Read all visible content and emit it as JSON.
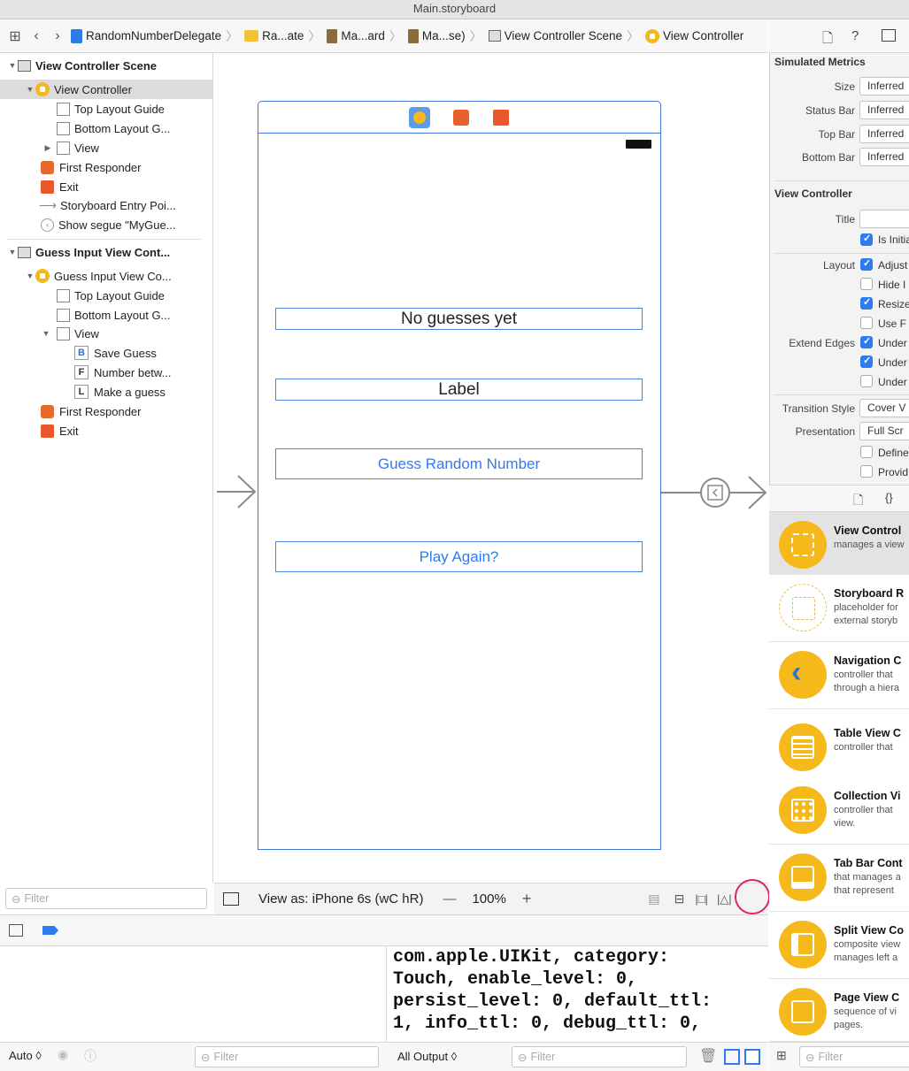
{
  "window": {
    "title": "Main.storyboard"
  },
  "jumpbar": {
    "crumbs": [
      "RandomNumberDelegate",
      "Ra...ate",
      "Ma...ard",
      "Ma...se)",
      "View Controller Scene",
      "View Controller"
    ]
  },
  "outline": {
    "scene1": {
      "title": "View Controller Scene",
      "vc": "View Controller",
      "top_guide": "Top Layout Guide",
      "bottom_guide": "Bottom Layout G...",
      "view": "View",
      "first_responder": "First Responder",
      "exit": "Exit",
      "entry_point": "Storyboard Entry Poi...",
      "segue": "Show segue \"MyGue..."
    },
    "scene2": {
      "title": "Guess Input View Cont...",
      "vc": "Guess Input View Co...",
      "top_guide": "Top Layout Guide",
      "bottom_guide": "Bottom Layout G...",
      "view": "View",
      "items": [
        {
          "letter": "B",
          "label": "Save Guess"
        },
        {
          "letter": "F",
          "label": "Number betw..."
        },
        {
          "letter": "L",
          "label": "Make a guess"
        }
      ],
      "first_responder": "First Responder",
      "exit": "Exit"
    },
    "filter_placeholder": "Filter"
  },
  "canvas": {
    "no_guesses_label": "No guesses yet",
    "label": "Label",
    "guess_button": "Guess Random Number",
    "play_again_button": "Play Again?",
    "view_as": "View as: iPhone 6s (wC hR)",
    "zoom": "100%"
  },
  "debug": {
    "console_lines": [
      "com.apple.UIKit, category:",
      "Touch, enable_level: 0,",
      "persist_level: 0, default_ttl:",
      "1, info_ttl: 0, debug_ttl: 0,"
    ],
    "auto_label": "Auto ◊",
    "filter_placeholder": "Filter",
    "output_selector": "All Output ◊"
  },
  "inspector": {
    "simulated_metrics": {
      "title": "Simulated Metrics",
      "rows": [
        {
          "label": "Size",
          "value": "Inferred"
        },
        {
          "label": "Status Bar",
          "value": "Inferred"
        },
        {
          "label": "Top Bar",
          "value": "Inferred"
        },
        {
          "label": "Bottom Bar",
          "value": "Inferred"
        }
      ]
    },
    "view_controller": {
      "title": "View Controller",
      "title_label": "Title",
      "is_initial": "Is Initial",
      "layout_label": "Layout",
      "layout_options": [
        {
          "label": "Adjust",
          "checked": true
        },
        {
          "label": "Hide I",
          "checked": false
        },
        {
          "label": "Resize",
          "checked": true
        },
        {
          "label": "Use F",
          "checked": false
        }
      ],
      "extend_label": "Extend Edges",
      "extend_options": [
        {
          "label": "Under",
          "checked": true
        },
        {
          "label": "Under",
          "checked": true
        },
        {
          "label": "Under",
          "checked": false
        }
      ],
      "transition_label": "Transition Style",
      "transition_value": "Cover V",
      "presentation_label": "Presentation",
      "presentation_value": "Full Scr",
      "define": "Define",
      "provide": "Provid"
    },
    "library": [
      {
        "title": "View Control",
        "desc": "manages a view"
      },
      {
        "title": "Storyboard R",
        "desc": "placeholder for\nexternal storyb"
      },
      {
        "title": "Navigation C",
        "desc": "controller that\nthrough a hiera"
      },
      {
        "title": "Table View C",
        "desc": "controller that"
      },
      {
        "title": "Collection Vi",
        "desc": "controller that\nview."
      },
      {
        "title": "Tab Bar Cont",
        "desc": "that manages a\nthat represent"
      },
      {
        "title": "Split View Co",
        "desc": "composite view\nmanages left a"
      },
      {
        "title": "Page View C",
        "desc": "sequence of vi\npages."
      }
    ],
    "filter_placeholder": "Filter"
  }
}
